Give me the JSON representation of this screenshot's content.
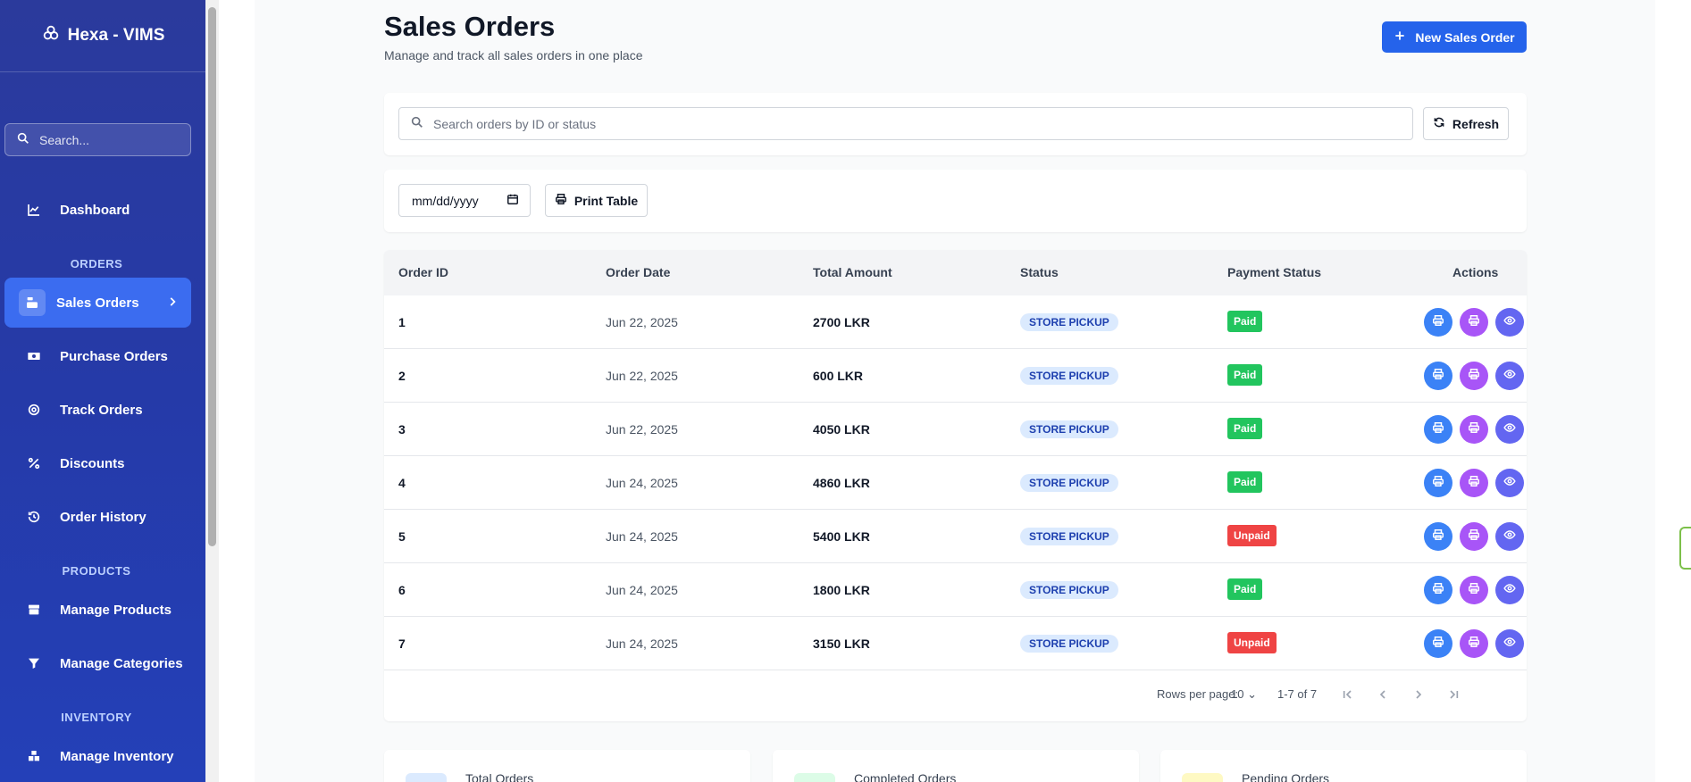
{
  "brand": {
    "name": "Hexa - VIMS"
  },
  "sidebar": {
    "search_placeholder": "Search...",
    "dashboard": "Dashboard",
    "sections": {
      "orders": "ORDERS",
      "products": "PRODUCTS",
      "inventory": "INVENTORY"
    },
    "items": {
      "sales_orders": "Sales Orders",
      "purchase_orders": "Purchase Orders",
      "track_orders": "Track Orders",
      "discounts": "Discounts",
      "order_history": "Order History",
      "manage_products": "Manage Products",
      "manage_categories": "Manage Categories",
      "manage_inventory": "Manage Inventory"
    }
  },
  "header": {
    "title": "Sales Orders",
    "subtitle": "Manage and track all sales orders in one place",
    "new_button": "New Sales Order"
  },
  "search": {
    "placeholder": "Search orders by ID or status",
    "refresh_label": "Refresh"
  },
  "filters": {
    "date_placeholder": "mm/dd/yyyy",
    "print_label": "Print Table"
  },
  "table": {
    "columns": [
      "Order ID",
      "Order Date",
      "Total Amount",
      "Status",
      "Payment Status",
      "Actions"
    ],
    "rows": [
      {
        "id": "1",
        "date": "Jun 22, 2025",
        "amount": "2700 LKR",
        "status": "STORE PICKUP",
        "payment": "Paid"
      },
      {
        "id": "2",
        "date": "Jun 22, 2025",
        "amount": "600 LKR",
        "status": "STORE PICKUP",
        "payment": "Paid"
      },
      {
        "id": "3",
        "date": "Jun 22, 2025",
        "amount": "4050 LKR",
        "status": "STORE PICKUP",
        "payment": "Paid"
      },
      {
        "id": "4",
        "date": "Jun 24, 2025",
        "amount": "4860 LKR",
        "status": "STORE PICKUP",
        "payment": "Paid"
      },
      {
        "id": "5",
        "date": "Jun 24, 2025",
        "amount": "5400 LKR",
        "status": "STORE PICKUP",
        "payment": "Unpaid"
      },
      {
        "id": "6",
        "date": "Jun 24, 2025",
        "amount": "1800 LKR",
        "status": "STORE PICKUP",
        "payment": "Paid"
      },
      {
        "id": "7",
        "date": "Jun 24, 2025",
        "amount": "3150 LKR",
        "status": "STORE PICKUP",
        "payment": "Unpaid"
      }
    ]
  },
  "pagination": {
    "rows_per_page_label": "Rows per page:",
    "rows_per_page_value": "10",
    "range": "1-7 of 7"
  },
  "stats": {
    "total": "Total Orders",
    "completed": "Completed Orders",
    "pending": "Pending Orders"
  },
  "colors": {
    "primary": "#2563eb",
    "paid": "#22c55e",
    "unpaid": "#ef4444",
    "sidebar": "#2b3a9c"
  }
}
